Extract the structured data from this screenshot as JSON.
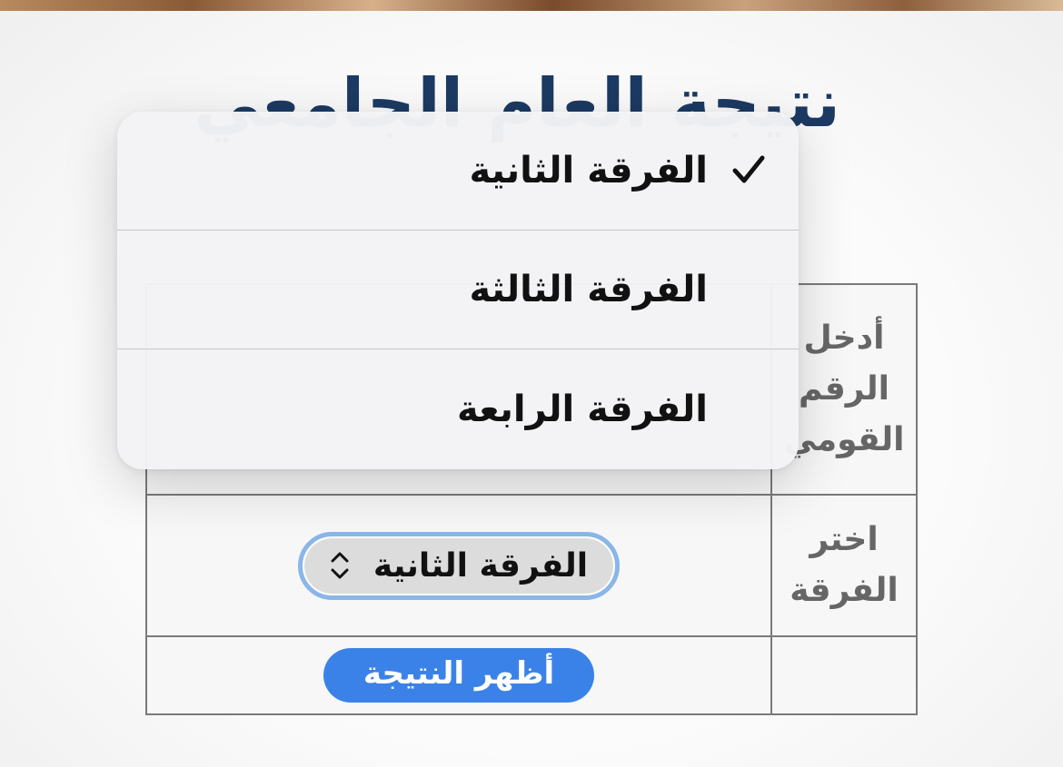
{
  "page": {
    "title": "نتيجة العام الجامعي"
  },
  "form": {
    "national_id_label": "أدخل الرقم القومي",
    "year_label": "اختر الفرقة",
    "year_selected": "الفرقة الثانية",
    "submit_label": "أظهر النتيجة"
  },
  "dropdown": {
    "options": [
      {
        "label": "الفرقة الثانية",
        "selected": true
      },
      {
        "label": "الفرقة الثالثة",
        "selected": false
      },
      {
        "label": "الفرقة الرابعة",
        "selected": false
      }
    ]
  },
  "colors": {
    "title": "#1c3a63",
    "button": "#3b82e8",
    "select_focus_ring": "#8ab6e8"
  },
  "icons": {
    "select_indicator": "chevron-up-down-icon",
    "selected_option": "checkmark-icon"
  }
}
